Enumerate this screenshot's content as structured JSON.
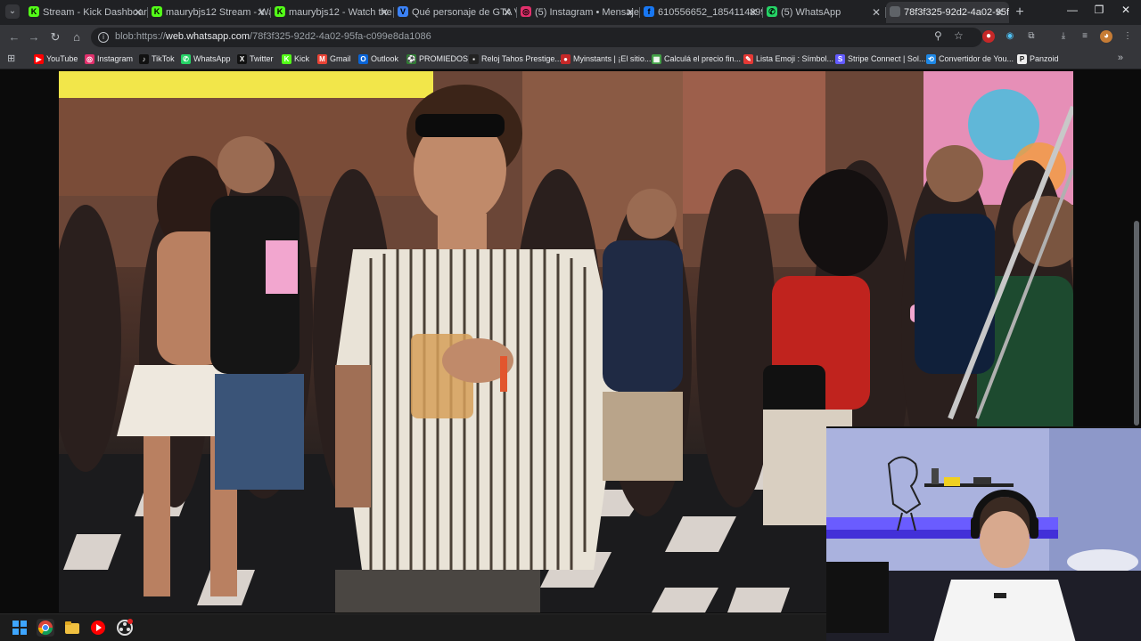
{
  "browser": {
    "tabs": [
      {
        "title": "Stream - Kick Dashboard",
        "fav": "K",
        "fav_color": "#53fc18"
      },
      {
        "title": "maurybjs12 Stream - Wat",
        "fav": "K",
        "fav_color": "#53fc18"
      },
      {
        "title": "maurybjs12 - Watch the V",
        "fav": "K",
        "fav_color": "#53fc18"
      },
      {
        "title": "Qué personaje de GTA Vi",
        "fav": "V",
        "fav_color": "#3b82f6"
      },
      {
        "title": "(5) Instagram • Mensajes",
        "fav": "◎",
        "fav_color": "#e1306c"
      },
      {
        "title": "610556652_1854114899",
        "fav": "f",
        "fav_color": "#1877f2"
      },
      {
        "title": "(5) WhatsApp",
        "fav": "✆",
        "fav_color": "#25d366"
      },
      {
        "title": "78f3f325-92d2-4a02-95f",
        "fav": "",
        "fav_color": "#5f6368"
      }
    ],
    "active_tab_index": 7,
    "url_prefix": "blob:https://",
    "url_host": "web.whatsapp.com",
    "url_path": "/78f3f325-92d2-4a02-95fa-c099e8da1086",
    "bookmarks": [
      {
        "label": "YouTube",
        "icon": "▶",
        "color": "#ff0000"
      },
      {
        "label": "Instagram",
        "icon": "◎",
        "color": "#e1306c"
      },
      {
        "label": "TikTok",
        "icon": "♪",
        "color": "#111111"
      },
      {
        "label": "WhatsApp",
        "icon": "✆",
        "color": "#25d366"
      },
      {
        "label": "Twitter",
        "icon": "X",
        "color": "#111111"
      },
      {
        "label": "Kick",
        "icon": "K",
        "color": "#53fc18"
      },
      {
        "label": "Gmail",
        "icon": "M",
        "color": "#ea4335"
      },
      {
        "label": "Outlook",
        "icon": "O",
        "color": "#0a64d6"
      },
      {
        "label": "PROMIEDOS",
        "icon": "⚽",
        "color": "#2e7d32"
      },
      {
        "label": "Reloj Tahos Prestige...",
        "icon": "▪",
        "color": "#222222"
      },
      {
        "label": "Myinstants | ¡El sitio...",
        "icon": "●",
        "color": "#c62828"
      },
      {
        "label": "Calculá el precio fin...",
        "icon": "▦",
        "color": "#43a047"
      },
      {
        "label": "Lista Emoji : Símbol...",
        "icon": "✎",
        "color": "#e53935"
      },
      {
        "label": "Stripe Connect | Sol...",
        "icon": "S",
        "color": "#635bff"
      },
      {
        "label": "Convertidor de You...",
        "icon": "⟲",
        "color": "#1e88e5"
      },
      {
        "label": "Panzoid",
        "icon": "P",
        "color": "#eeeeee"
      }
    ]
  },
  "icons": {
    "tab_search": "chevron-down-icon",
    "back": "arrow-left-icon",
    "forward": "arrow-right-icon",
    "reload": "reload-icon",
    "home": "home-icon",
    "zoom": "zoom-icon",
    "star": "star-icon",
    "extensions": "puzzle-icon",
    "download": "download-icon"
  },
  "taskbar": {
    "apps": [
      "windows-start",
      "chrome",
      "file-explorer",
      "youtube-music",
      "obs"
    ]
  }
}
